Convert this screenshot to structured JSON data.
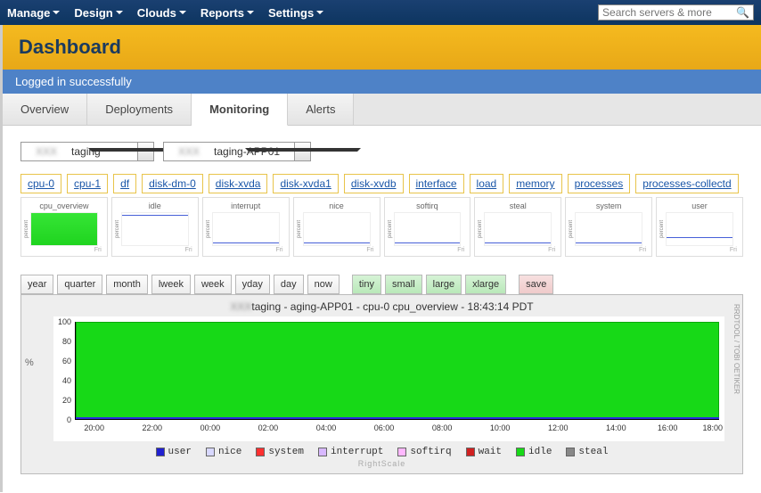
{
  "nav": {
    "items": [
      "Manage",
      "Design",
      "Clouds",
      "Reports",
      "Settings"
    ],
    "search_placeholder": "Search servers & more"
  },
  "page_title": "Dashboard",
  "flash": "Logged in successfully",
  "tabs": [
    "Overview",
    "Deployments",
    "Monitoring",
    "Alerts"
  ],
  "active_tab": "Monitoring",
  "selects": {
    "deployment": "taging",
    "server": "taging-APP01"
  },
  "metrics": [
    "cpu-0",
    "cpu-1",
    "df",
    "disk-dm-0",
    "disk-xvda",
    "disk-xvda1",
    "disk-xvdb",
    "interface",
    "load",
    "memory",
    "processes",
    "processes-collectd"
  ],
  "thumbs": [
    {
      "label": "cpu_overview",
      "style": "green"
    },
    {
      "label": "idle",
      "style": "line-top"
    },
    {
      "label": "interrupt",
      "style": "line-bottom"
    },
    {
      "label": "nice",
      "style": "line-bottom"
    },
    {
      "label": "softirq",
      "style": "line-bottom"
    },
    {
      "label": "steal",
      "style": "line-bottom"
    },
    {
      "label": "system",
      "style": "line-bottom"
    },
    {
      "label": "user",
      "style": "line-bottom"
    }
  ],
  "time_ranges": [
    "year",
    "quarter",
    "month",
    "lweek",
    "week",
    "yday",
    "day",
    "now"
  ],
  "sizes": [
    "tiny",
    "small",
    "large",
    "xlarge"
  ],
  "save_label": "save",
  "chart_title": "taging -            aging-APP01 - cpu-0 cpu_overview - 18:43:14 PDT",
  "chart_data": {
    "type": "area",
    "title": "cpu-0 cpu_overview",
    "ylim": [
      0,
      100
    ],
    "y_ticks": [
      0,
      20,
      40,
      60,
      80,
      100
    ],
    "x_ticks": [
      "20:00",
      "22:00",
      "00:00",
      "02:00",
      "04:00",
      "06:00",
      "08:00",
      "10:00",
      "12:00",
      "14:00",
      "16:00",
      "18:00"
    ],
    "series": [
      {
        "name": "user",
        "color": "#2020d0",
        "approx": "~1-3% baseline"
      },
      {
        "name": "nice",
        "color": "#d8d8ff",
        "approx": "0%"
      },
      {
        "name": "system",
        "color": "#ff3030",
        "approx": "<1%"
      },
      {
        "name": "interrupt",
        "color": "#d8b8ff",
        "approx": "0%"
      },
      {
        "name": "softirq",
        "color": "#ffb8ff",
        "approx": "0%"
      },
      {
        "name": "wait",
        "color": "#d02020",
        "approx": "0%"
      },
      {
        "name": "idle",
        "color": "#17d917",
        "approx": "~97-99%"
      },
      {
        "name": "steal",
        "color": "#888",
        "approx": "0%"
      }
    ]
  },
  "legend": [
    {
      "label": "user",
      "color": "#2020d0"
    },
    {
      "label": "nice",
      "color": "#d8d8ff"
    },
    {
      "label": "system",
      "color": "#ff3030"
    },
    {
      "label": "interrupt",
      "color": "#d8b8ff"
    },
    {
      "label": "softirq",
      "color": "#ffb8ff"
    },
    {
      "label": "wait",
      "color": "#d02020"
    },
    {
      "label": "idle",
      "color": "#17d917"
    },
    {
      "label": "steal",
      "color": "#888888"
    }
  ],
  "tool_credit": "RRDTOOL / TOBI OETIKER",
  "chart_footer": "RightScale",
  "thumb_xlabel": "Fri"
}
